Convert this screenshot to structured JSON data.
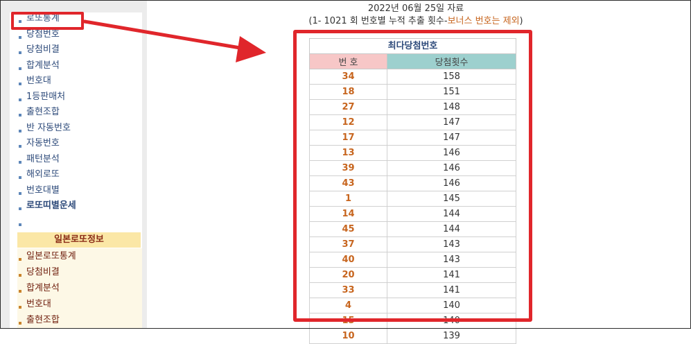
{
  "sidebar": {
    "items": [
      {
        "label": "로또통계",
        "bold": false
      },
      {
        "label": "당첨번호",
        "bold": false
      },
      {
        "label": "당첨비결",
        "bold": false
      },
      {
        "label": "합계분석",
        "bold": false
      },
      {
        "label": "번호대",
        "bold": false
      },
      {
        "label": "1등판매처",
        "bold": false
      },
      {
        "label": "출현조합",
        "bold": false
      },
      {
        "label": "반 자동번호",
        "bold": false
      },
      {
        "label": "자동번호",
        "bold": false
      },
      {
        "label": "패턴분석",
        "bold": false
      },
      {
        "label": "해외로또",
        "bold": false
      },
      {
        "label": "번호대별",
        "bold": false
      },
      {
        "label": "로또띠별운세",
        "bold": true
      },
      {
        "label": "",
        "bold": false
      }
    ],
    "jp_section": {
      "title": "일본로또정보",
      "items": [
        "일본로또통계",
        "당첨비결",
        "합계분석",
        "번호대",
        "출현조합"
      ]
    }
  },
  "header": {
    "date": "2022년 06월 25일 자료",
    "desc_prefix": "(1- 1021 회 번호별 누적 추출 횟수-",
    "desc_highlight": "보너스 번호는 제외",
    "desc_suffix": ")"
  },
  "table": {
    "caption": "최다당첨번호",
    "col_number": "번 호",
    "col_count": "당첨횟수",
    "rows": [
      {
        "number": "34",
        "count": "158"
      },
      {
        "number": "18",
        "count": "151"
      },
      {
        "number": "27",
        "count": "148"
      },
      {
        "number": "12",
        "count": "147"
      },
      {
        "number": "17",
        "count": "147"
      },
      {
        "number": "13",
        "count": "146"
      },
      {
        "number": "39",
        "count": "146"
      },
      {
        "number": "43",
        "count": "146"
      },
      {
        "number": "1",
        "count": "145"
      },
      {
        "number": "14",
        "count": "144"
      },
      {
        "number": "45",
        "count": "144"
      },
      {
        "number": "37",
        "count": "143"
      },
      {
        "number": "40",
        "count": "143"
      },
      {
        "number": "20",
        "count": "141"
      },
      {
        "number": "33",
        "count": "141"
      },
      {
        "number": "4",
        "count": "140"
      },
      {
        "number": "15",
        "count": "140"
      },
      {
        "number": "10",
        "count": "139"
      }
    ]
  },
  "colors": {
    "annotation_red": "#e0262b",
    "number_orange": "#c7651e",
    "menu_blue": "#2d4a7a",
    "header_pink": "#f7c7c7",
    "header_teal": "#9dd0ce",
    "jp_header_bg": "#fbe7a6"
  }
}
